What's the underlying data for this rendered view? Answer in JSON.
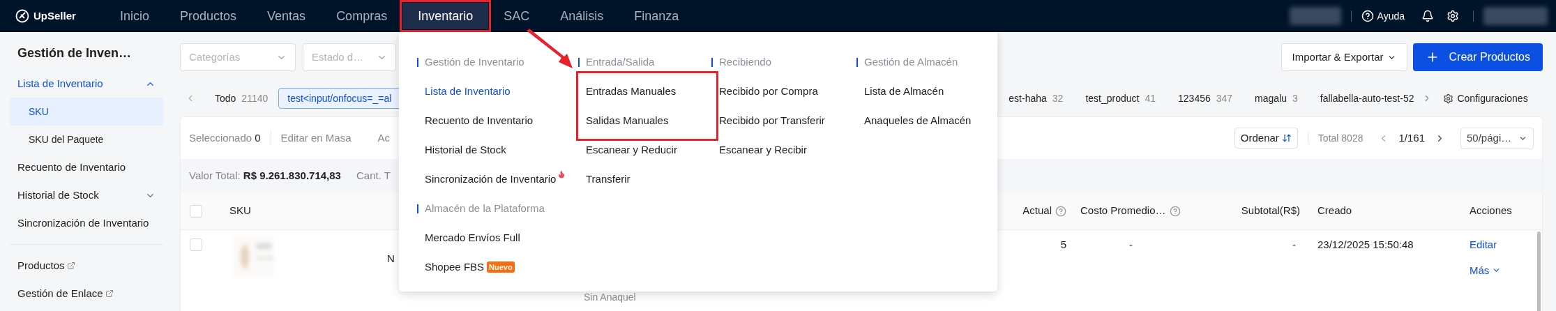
{
  "top_nav": {
    "logo": "UpSeller",
    "items": [
      {
        "label": "Inicio",
        "selected": false,
        "annotated": false
      },
      {
        "label": "Productos",
        "selected": false,
        "annotated": false
      },
      {
        "label": "Ventas",
        "selected": false,
        "annotated": false
      },
      {
        "label": "Compras",
        "selected": false,
        "annotated": false
      },
      {
        "label": "Inventario",
        "selected": true,
        "annotated": true
      },
      {
        "label": "SAC",
        "selected": false,
        "annotated": false
      },
      {
        "label": "Análisis",
        "selected": false,
        "annotated": false
      },
      {
        "label": "Finanza",
        "selected": false,
        "annotated": false
      }
    ],
    "help": "Ayuda"
  },
  "sidebar": {
    "title": "Gestión de Inven…",
    "items": [
      {
        "label": "Lista de Inventario",
        "selected": true,
        "expanded": true,
        "children": [
          {
            "label": "SKU",
            "selected": true
          },
          {
            "label": "SKU del Paquete",
            "selected": false
          }
        ]
      },
      {
        "label": "Recuento de Inventario",
        "selected": false
      },
      {
        "label": "Historial de Stock",
        "selected": false,
        "expanded": false
      },
      {
        "label": "Sincronización de Inventario",
        "selected": false
      }
    ],
    "links": [
      {
        "label": "Productos"
      },
      {
        "label": "Gestión de Enlace"
      }
    ]
  },
  "filters": [
    {
      "placeholder": "Categorías"
    },
    {
      "placeholder": "Estado d…"
    }
  ],
  "actions": [
    {
      "kind": "secondary",
      "label": "Importar & Exportar"
    },
    {
      "kind": "primary",
      "label": "Crear Productos"
    }
  ],
  "store_tabs": {
    "left": [
      {
        "name": "Todo",
        "count": "21140",
        "selected": false
      },
      {
        "name": "test<input/onfocus=_=al",
        "selected": true
      }
    ],
    "right": [
      {
        "name": "est-haha",
        "count": "32",
        "selected": false
      },
      {
        "name": "test_product",
        "count": "41",
        "selected": false
      },
      {
        "name": "123456",
        "count": "347",
        "selected": false
      },
      {
        "name": "magalu",
        "count": "3",
        "selected": false
      },
      {
        "name": "fallabella-auto-test-52",
        "selected": false
      }
    ],
    "settings": "Configuraciones"
  },
  "toolbar": {
    "selected_label": "Seleccionado",
    "selected_count": "0",
    "bulk_edit": "Editar en Masa",
    "cut_action": "Ac",
    "sort": "Ordenar",
    "total": "Total 8028",
    "page": "1/161",
    "page_size": "50/pági…"
  },
  "summary": {
    "label": "Valor Total:",
    "value": "R$ 9.261.830.714,83",
    "cut_label": "Cant. T"
  },
  "table": {
    "all_checked": false,
    "columns": [
      {
        "label": "SKU",
        "help": false
      },
      {
        "label": "Actual",
        "help": true
      },
      {
        "label": "Costo Promedio…",
        "help": true
      },
      {
        "label": "Subtotal(R$)",
        "help": false
      },
      {
        "label": "Creado",
        "help": false
      },
      {
        "label": "Acciones",
        "help": false
      }
    ],
    "rows": [
      {
        "checked": false,
        "cut_text": "N",
        "shelf": "Sin Anaquel",
        "actual": "5",
        "cost": "-",
        "subtotal": "-",
        "created": "23/12/2025 15:50:48",
        "actions": [
          "Editar",
          "Más"
        ]
      }
    ]
  },
  "dropdown": {
    "columns": [
      {
        "sections": [
          {
            "title": "Gestión de Inventario",
            "items": [
              {
                "label": "Lista de Inventario",
                "selected": true,
                "hot": false,
                "annotated": false
              },
              {
                "label": "Recuento de Inventario",
                "selected": false,
                "hot": false,
                "annotated": false
              },
              {
                "label": "Historial de Stock",
                "selected": false,
                "hot": false,
                "annotated": false
              },
              {
                "label": "Sincronización de Inventario",
                "selected": false,
                "hot": true,
                "annotated": false
              }
            ]
          },
          {
            "title": "Almacén de la Plataforma",
            "items": [
              {
                "label": "Mercado Envíos Full",
                "selected": false,
                "hot": false,
                "annotated": false
              },
              {
                "label": "Shopee FBS",
                "badge": "Nuevo",
                "selected": false,
                "hot": false,
                "annotated": false
              }
            ]
          }
        ]
      },
      {
        "sections": [
          {
            "title": "Entrada/Salida",
            "items": [
              {
                "label": "Entradas Manuales",
                "selected": false,
                "hot": false,
                "annotated": true
              },
              {
                "label": "Salidas Manuales",
                "selected": false,
                "hot": false,
                "annotated": true
              },
              {
                "label": "Escanear y Reducir",
                "selected": false,
                "hot": false,
                "annotated": false
              },
              {
                "label": "Transferir",
                "selected": false,
                "hot": false,
                "annotated": false
              }
            ]
          }
        ]
      },
      {
        "sections": [
          {
            "title": "Recibiendo",
            "items": [
              {
                "label": "Recibido por Compra",
                "selected": false,
                "hot": false,
                "annotated": false
              },
              {
                "label": "Recibido por Transferir",
                "selected": false,
                "hot": false,
                "annotated": false
              },
              {
                "label": "Escanear y Recibir",
                "selected": false,
                "hot": false,
                "annotated": false
              }
            ]
          }
        ]
      },
      {
        "sections": [
          {
            "title": "Gestión de Almacén",
            "items": [
              {
                "label": "Lista de Almacén",
                "selected": false,
                "hot": false,
                "annotated": false
              },
              {
                "label": "Anaqueles de Almacén",
                "selected": false,
                "hot": false,
                "annotated": false
              }
            ]
          }
        ]
      }
    ]
  }
}
